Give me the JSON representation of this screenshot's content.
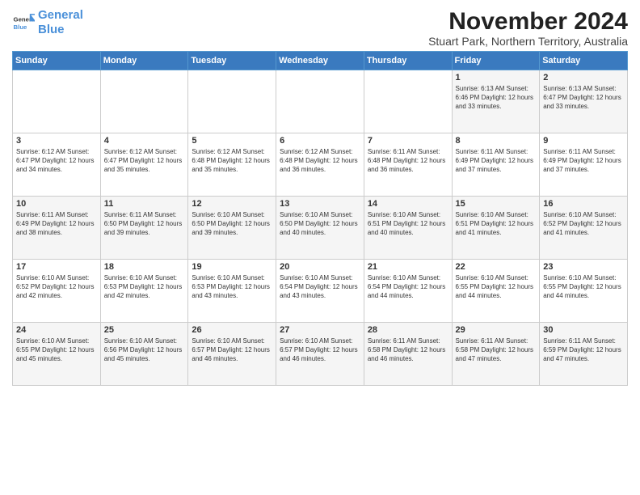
{
  "logo": {
    "line1": "General",
    "line2": "Blue"
  },
  "title": "November 2024",
  "subtitle": "Stuart Park, Northern Territory, Australia",
  "days_of_week": [
    "Sunday",
    "Monday",
    "Tuesday",
    "Wednesday",
    "Thursday",
    "Friday",
    "Saturday"
  ],
  "weeks": [
    [
      {
        "num": "",
        "info": ""
      },
      {
        "num": "",
        "info": ""
      },
      {
        "num": "",
        "info": ""
      },
      {
        "num": "",
        "info": ""
      },
      {
        "num": "",
        "info": ""
      },
      {
        "num": "1",
        "info": "Sunrise: 6:13 AM\nSunset: 6:46 PM\nDaylight: 12 hours and 33 minutes."
      },
      {
        "num": "2",
        "info": "Sunrise: 6:13 AM\nSunset: 6:47 PM\nDaylight: 12 hours and 33 minutes."
      }
    ],
    [
      {
        "num": "3",
        "info": "Sunrise: 6:12 AM\nSunset: 6:47 PM\nDaylight: 12 hours and 34 minutes."
      },
      {
        "num": "4",
        "info": "Sunrise: 6:12 AM\nSunset: 6:47 PM\nDaylight: 12 hours and 35 minutes."
      },
      {
        "num": "5",
        "info": "Sunrise: 6:12 AM\nSunset: 6:48 PM\nDaylight: 12 hours and 35 minutes."
      },
      {
        "num": "6",
        "info": "Sunrise: 6:12 AM\nSunset: 6:48 PM\nDaylight: 12 hours and 36 minutes."
      },
      {
        "num": "7",
        "info": "Sunrise: 6:11 AM\nSunset: 6:48 PM\nDaylight: 12 hours and 36 minutes."
      },
      {
        "num": "8",
        "info": "Sunrise: 6:11 AM\nSunset: 6:49 PM\nDaylight: 12 hours and 37 minutes."
      },
      {
        "num": "9",
        "info": "Sunrise: 6:11 AM\nSunset: 6:49 PM\nDaylight: 12 hours and 37 minutes."
      }
    ],
    [
      {
        "num": "10",
        "info": "Sunrise: 6:11 AM\nSunset: 6:49 PM\nDaylight: 12 hours and 38 minutes."
      },
      {
        "num": "11",
        "info": "Sunrise: 6:11 AM\nSunset: 6:50 PM\nDaylight: 12 hours and 39 minutes."
      },
      {
        "num": "12",
        "info": "Sunrise: 6:10 AM\nSunset: 6:50 PM\nDaylight: 12 hours and 39 minutes."
      },
      {
        "num": "13",
        "info": "Sunrise: 6:10 AM\nSunset: 6:50 PM\nDaylight: 12 hours and 40 minutes."
      },
      {
        "num": "14",
        "info": "Sunrise: 6:10 AM\nSunset: 6:51 PM\nDaylight: 12 hours and 40 minutes."
      },
      {
        "num": "15",
        "info": "Sunrise: 6:10 AM\nSunset: 6:51 PM\nDaylight: 12 hours and 41 minutes."
      },
      {
        "num": "16",
        "info": "Sunrise: 6:10 AM\nSunset: 6:52 PM\nDaylight: 12 hours and 41 minutes."
      }
    ],
    [
      {
        "num": "17",
        "info": "Sunrise: 6:10 AM\nSunset: 6:52 PM\nDaylight: 12 hours and 42 minutes."
      },
      {
        "num": "18",
        "info": "Sunrise: 6:10 AM\nSunset: 6:53 PM\nDaylight: 12 hours and 42 minutes."
      },
      {
        "num": "19",
        "info": "Sunrise: 6:10 AM\nSunset: 6:53 PM\nDaylight: 12 hours and 43 minutes."
      },
      {
        "num": "20",
        "info": "Sunrise: 6:10 AM\nSunset: 6:54 PM\nDaylight: 12 hours and 43 minutes."
      },
      {
        "num": "21",
        "info": "Sunrise: 6:10 AM\nSunset: 6:54 PM\nDaylight: 12 hours and 44 minutes."
      },
      {
        "num": "22",
        "info": "Sunrise: 6:10 AM\nSunset: 6:55 PM\nDaylight: 12 hours and 44 minutes."
      },
      {
        "num": "23",
        "info": "Sunrise: 6:10 AM\nSunset: 6:55 PM\nDaylight: 12 hours and 44 minutes."
      }
    ],
    [
      {
        "num": "24",
        "info": "Sunrise: 6:10 AM\nSunset: 6:55 PM\nDaylight: 12 hours and 45 minutes."
      },
      {
        "num": "25",
        "info": "Sunrise: 6:10 AM\nSunset: 6:56 PM\nDaylight: 12 hours and 45 minutes."
      },
      {
        "num": "26",
        "info": "Sunrise: 6:10 AM\nSunset: 6:57 PM\nDaylight: 12 hours and 46 minutes."
      },
      {
        "num": "27",
        "info": "Sunrise: 6:10 AM\nSunset: 6:57 PM\nDaylight: 12 hours and 46 minutes."
      },
      {
        "num": "28",
        "info": "Sunrise: 6:11 AM\nSunset: 6:58 PM\nDaylight: 12 hours and 46 minutes."
      },
      {
        "num": "29",
        "info": "Sunrise: 6:11 AM\nSunset: 6:58 PM\nDaylight: 12 hours and 47 minutes."
      },
      {
        "num": "30",
        "info": "Sunrise: 6:11 AM\nSunset: 6:59 PM\nDaylight: 12 hours and 47 minutes."
      }
    ]
  ]
}
